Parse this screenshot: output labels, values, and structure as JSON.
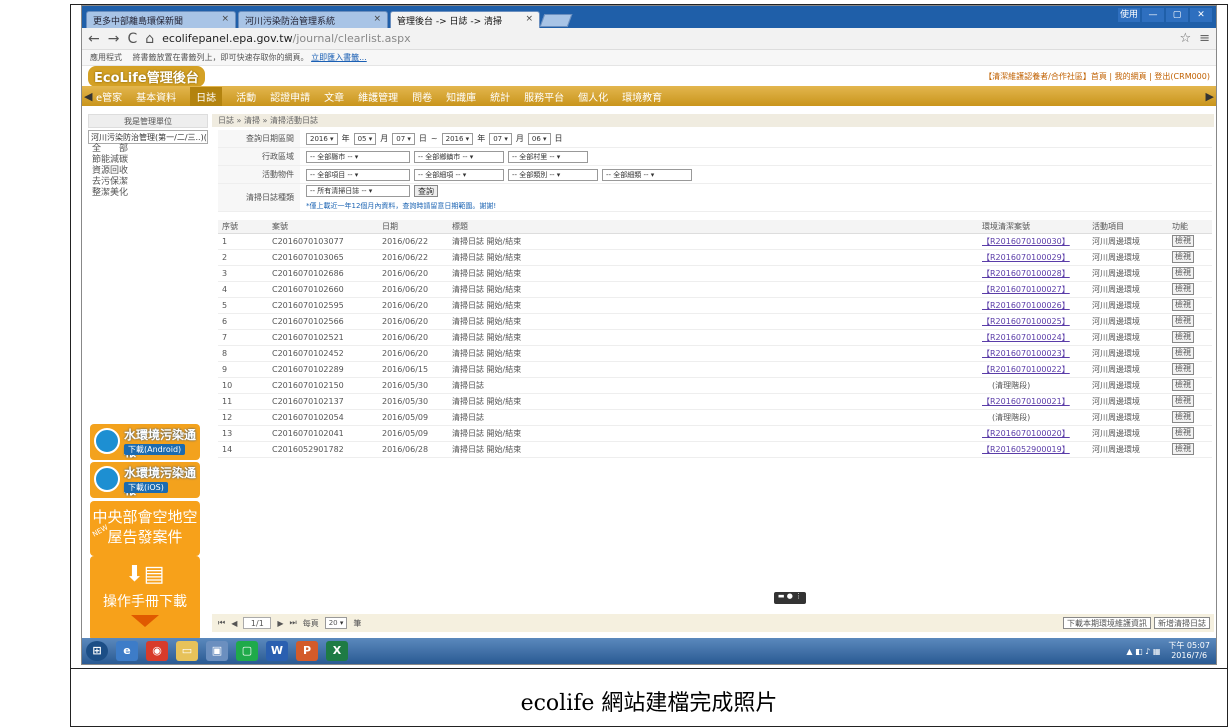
{
  "browser": {
    "tabs": [
      {
        "label": "更多中部離島環保新聞",
        "active": false
      },
      {
        "label": "河川污染防治管理系統",
        "active": false
      },
      {
        "label": "管理後台 -> 日誌 -> 清掃",
        "active": true
      }
    ],
    "window_controls": [
      "使用",
      "—",
      "▢",
      "✕"
    ],
    "url_host": "ecolifepanel.epa.gov.tw",
    "url_path": "/journal/clearlist.aspx",
    "bookmarks_text": "應用程式 　將書籤放置在書籤列上，即可快速存取你的網頁。",
    "bookmarks_link": "立即匯入書籤..."
  },
  "site": {
    "logo": "EcoLife管理後台",
    "toplinks": "【清潔維護認養者/合作社區】首頁 | 我的網頁 | 登出(CRM000)",
    "menu": [
      "e管家",
      "基本資料",
      "日誌",
      "活動",
      "認證申請",
      "文章",
      "維護管理",
      "問卷",
      "知識庫",
      "統計",
      "服務平台",
      "個人化",
      "環境教育"
    ],
    "menu_active": "日誌"
  },
  "sidebar": {
    "header": "我是管理單位",
    "select_value": "河川污染防治管理(第一/二/三..)(C)",
    "items": [
      "全　　部",
      "節能減碳",
      "資源回收",
      "去污保潔",
      "整潔美化"
    ],
    "promos": [
      {
        "title": "水環境污染通報",
        "sub": "下載(Android)"
      },
      {
        "title": "水環境污染通報",
        "sub": "下載(iOS)"
      }
    ],
    "promo3_text": "中央部會空地空屋告發案件",
    "promo3_badge": "NEW",
    "promo4_text": "操作手冊下載"
  },
  "breadcrumb": "日誌 » 清掃 » 清掃活動日誌",
  "filters": {
    "date": {
      "label": "查詢日期區間",
      "y1": "2016",
      "m1": "05",
      "d1": "07",
      "y2": "2016",
      "m2": "07",
      "d2": "06",
      "u_year": "年",
      "u_month": "月",
      "u_day": "日",
      "sep": "~"
    },
    "area": {
      "label": "行政區域",
      "opts": [
        "-- 全部縣市 --",
        "-- 全部鄉鎮市 --",
        "-- 全部村里 --"
      ]
    },
    "item": {
      "label": "活動物件",
      "opts": [
        "-- 全部項目 --",
        "-- 全部細項 --",
        "-- 全部類別 --",
        "-- 全部細類 --"
      ]
    },
    "type": {
      "label": "清掃日誌種類",
      "value": "-- 所有清掃日誌 --",
      "button": "查詢"
    },
    "hint": "*僅上載近一年12個月內資料，查詢時請留意日期範圍。謝謝!"
  },
  "table": {
    "headers": [
      "序號",
      "案號",
      "日期",
      "標題",
      "環境清潔案號",
      "活動項目",
      "功能"
    ],
    "rows": [
      [
        "1",
        "C2016070103077",
        "2016/06/22",
        "清掃日誌 開始/結束",
        "【R2016070100030】",
        "河川周邊環境",
        "檢視"
      ],
      [
        "2",
        "C2016070103065",
        "2016/06/22",
        "清掃日誌 開始/結束",
        "【R2016070100029】",
        "河川周邊環境",
        "檢視"
      ],
      [
        "3",
        "C2016070102686",
        "2016/06/20",
        "清掃日誌 開始/結束",
        "【R2016070100028】",
        "河川周邊環境",
        "檢視"
      ],
      [
        "4",
        "C2016070102660",
        "2016/06/20",
        "清掃日誌 開始/結束",
        "【R2016070100027】",
        "河川周邊環境",
        "檢視"
      ],
      [
        "5",
        "C2016070102595",
        "2016/06/20",
        "清掃日誌 開始/結束",
        "【R2016070100026】",
        "河川周邊環境",
        "檢視"
      ],
      [
        "6",
        "C2016070102566",
        "2016/06/20",
        "清掃日誌 開始/結束",
        "【R2016070100025】",
        "河川周邊環境",
        "檢視"
      ],
      [
        "7",
        "C2016070102521",
        "2016/06/20",
        "清掃日誌 開始/結束",
        "【R2016070100024】",
        "河川周邊環境",
        "檢視"
      ],
      [
        "8",
        "C2016070102452",
        "2016/06/20",
        "清掃日誌 開始/結束",
        "【R2016070100023】",
        "河川周邊環境",
        "檢視"
      ],
      [
        "9",
        "C2016070102289",
        "2016/06/15",
        "清掃日誌 開始/結束",
        "【R2016070100022】",
        "河川周邊環境",
        "檢視"
      ],
      [
        "10",
        "C2016070102150",
        "2016/05/30",
        "清掃日誌",
        "(清理階段)",
        "河川周邊環境",
        "檢視"
      ],
      [
        "11",
        "C2016070102137",
        "2016/05/30",
        "清掃日誌 開始/結束",
        "【R2016070100021】",
        "河川周邊環境",
        "檢視"
      ],
      [
        "12",
        "C2016070102054",
        "2016/05/09",
        "清掃日誌",
        "(清理階段)",
        "河川周邊環境",
        "檢視"
      ],
      [
        "13",
        "C2016070102041",
        "2016/05/09",
        "清掃日誌 開始/結束",
        "【R2016070100020】",
        "河川周邊環境",
        "檢視"
      ],
      [
        "14",
        "C2016052901782",
        "2016/06/28",
        "清掃日誌 開始/結束",
        "【R2016052900019】",
        "河川周邊環境",
        "檢視"
      ]
    ]
  },
  "pager": {
    "page": "1/1",
    "per_label": "每頁",
    "per_value": "20",
    "per_unit": "筆",
    "btn1": "下載本期環境維護資訊",
    "btn2": "新增清掃日誌"
  },
  "taskbar": {
    "time": "下午 05:07",
    "date": "2016/7/6"
  },
  "caption": "ecolife 網站建檔完成照片",
  "colors": {
    "menu": "#d9a532",
    "taskbar": "#2a5a93",
    "link": "#5a3ca8",
    "promo": "#f3a21d"
  }
}
